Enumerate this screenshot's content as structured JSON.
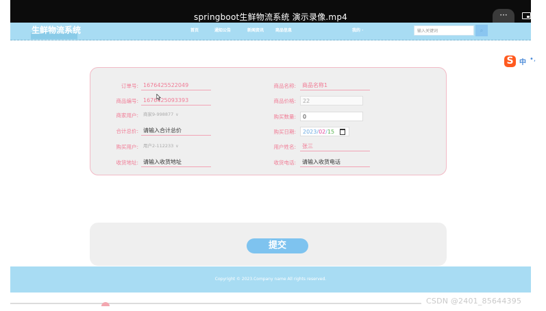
{
  "player": {
    "title": "springboot生鲜物流系统 演示录像.mp4",
    "more": "···"
  },
  "nav": {
    "brand": "生鲜物流系统",
    "links": [
      "首页",
      "通知公告",
      "新闻资讯",
      "商品信息",
      "我的 ·"
    ],
    "search_placeholder": "输入关键词"
  },
  "ime": {
    "logo": "S",
    "mode": "中",
    "punct": "•,"
  },
  "form": {
    "order_no": {
      "label": "订单号:",
      "value": "1676425522049"
    },
    "product_code": {
      "label": "商品编号:",
      "value": "1676425093393"
    },
    "merchant": {
      "label": "商家用户:",
      "value": "商家9-998877"
    },
    "total": {
      "label": "合计总价:",
      "placeholder": "请输入合计总价"
    },
    "buyer": {
      "label": "购买用户:",
      "value": "用户2-112233"
    },
    "address": {
      "label": "收货地址:",
      "placeholder": "请输入收货地址"
    },
    "product_name": {
      "label": "商品名称:",
      "value": "商品名称1"
    },
    "price": {
      "label": "商品价格:",
      "value": "22"
    },
    "quantity": {
      "label": "购买数量:",
      "value": "0"
    },
    "date": {
      "label": "购买日期:",
      "year": "2023",
      "month": "02",
      "day": "15"
    },
    "user_name": {
      "label": "用户姓名:",
      "value": "张三"
    },
    "phone": {
      "label": "收货电话:",
      "placeholder": "请输入收货电话"
    }
  },
  "submit_label": "提交",
  "footer": {
    "copyright": "Copyright © 2023.Company name All rights reserved."
  },
  "watermark": "CSDN @2401_85644395",
  "colors": {
    "nav": "#a8dcf3",
    "label": "#f07b95",
    "button": "#7ec3ef"
  }
}
